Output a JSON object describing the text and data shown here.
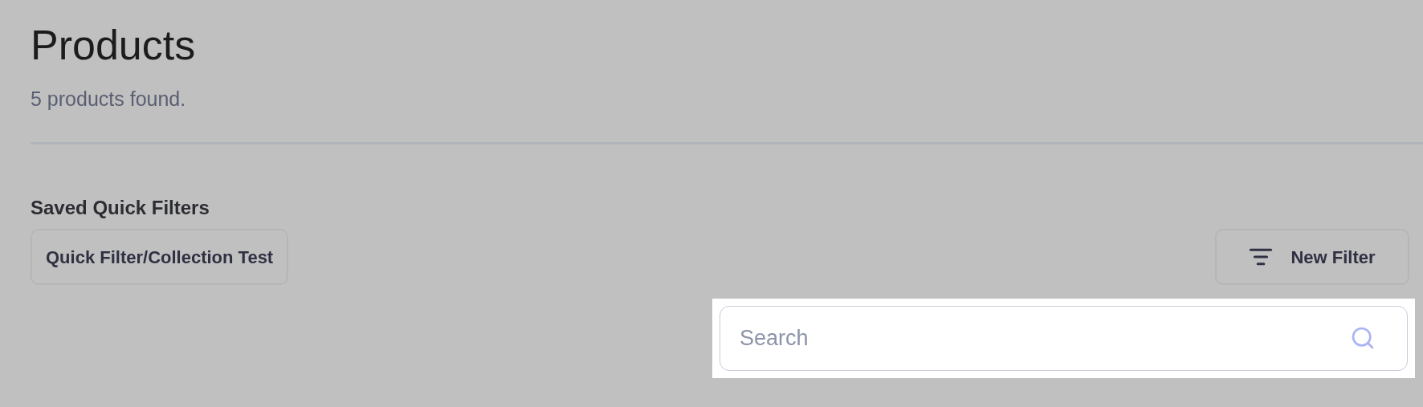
{
  "page": {
    "title": "Products",
    "subtitle": "5 products found."
  },
  "quick_filters": {
    "heading": "Saved Quick Filters",
    "items": [
      {
        "label": "Quick Filter/Collection Test"
      }
    ],
    "new_filter_button": "New Filter"
  },
  "search": {
    "placeholder": "Search"
  }
}
